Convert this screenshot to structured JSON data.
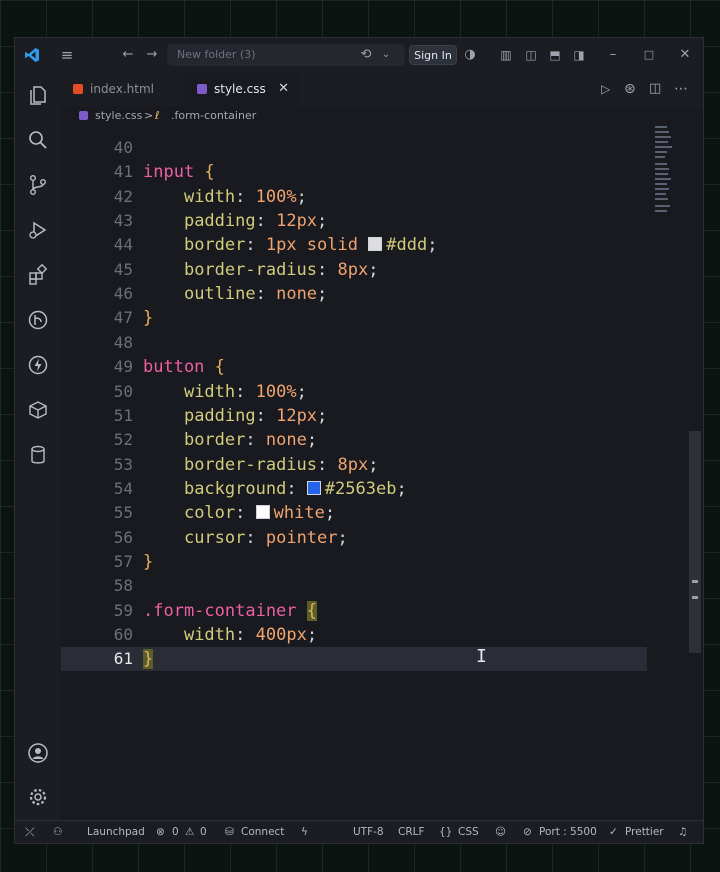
{
  "window": {
    "search_placeholder": "New folder (3)",
    "sign_in": "Sign In"
  },
  "tabs": [
    {
      "label": "index.html",
      "active": false,
      "icon": "html-file-icon"
    },
    {
      "label": "style.css",
      "active": true,
      "icon": "css-file-icon"
    }
  ],
  "breadcrumb": {
    "file": "style.css",
    "separator": ">",
    "symbol": ".form-container"
  },
  "code": {
    "current_line": 61,
    "lines": [
      {
        "n": "40"
      },
      {
        "n": "41",
        "sel": "input",
        "open": " {"
      },
      {
        "n": "42",
        "prop": "width",
        "val": "100%"
      },
      {
        "n": "43",
        "prop": "padding",
        "val": "12px"
      },
      {
        "n": "44",
        "prop": "border",
        "val": "1px solid",
        "swatch": "#dddddd",
        "hex": "#ddd"
      },
      {
        "n": "45",
        "prop": "border-radius",
        "val": "8px"
      },
      {
        "n": "46",
        "prop": "outline",
        "val": "none"
      },
      {
        "n": "47",
        "close": "}"
      },
      {
        "n": "48"
      },
      {
        "n": "49",
        "sel": "button",
        "open": " {"
      },
      {
        "n": "50",
        "prop": "width",
        "val": "100%"
      },
      {
        "n": "51",
        "prop": "padding",
        "val": "12px"
      },
      {
        "n": "52",
        "prop": "border",
        "val": "none"
      },
      {
        "n": "53",
        "prop": "border-radius",
        "val": "8px"
      },
      {
        "n": "54",
        "prop": "background",
        "swatch": "#2563eb",
        "hex": "#2563eb"
      },
      {
        "n": "55",
        "prop": "color",
        "swatch": "#ffffff",
        "val2": "white"
      },
      {
        "n": "56",
        "prop": "cursor",
        "val": "pointer"
      },
      {
        "n": "57",
        "close": "}"
      },
      {
        "n": "58"
      },
      {
        "n": "59",
        "cls": ".form-container",
        "open": " {"
      },
      {
        "n": "60",
        "prop": "width",
        "val": "400px"
      },
      {
        "n": "61",
        "close": "}",
        "current": true
      }
    ]
  },
  "status": {
    "launchpad": "Launchpad",
    "errors": "0",
    "warnings": "0",
    "connect": "Connect",
    "encoding": "UTF-8",
    "eol": "CRLF",
    "language": "CSS",
    "port": "Port : 5500",
    "prettier": "Prettier"
  },
  "colors": {
    "accent": "#2563eb",
    "selector": "#ec5fa1",
    "property": "#d1cb7c",
    "value": "#f0a36f"
  }
}
